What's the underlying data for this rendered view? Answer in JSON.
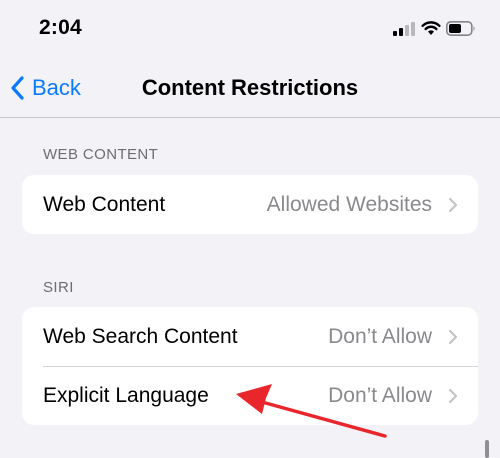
{
  "status_bar": {
    "time": "2:04",
    "icons": [
      "cellular-signal-icon",
      "wifi-icon",
      "battery-icon"
    ]
  },
  "nav": {
    "back_label": "Back",
    "title": "Content Restrictions"
  },
  "sections": {
    "web_content": {
      "header": "WEB CONTENT",
      "rows": [
        {
          "label": "Web Content",
          "value": "Allowed Websites"
        }
      ]
    },
    "siri": {
      "header": "SIRI",
      "rows": [
        {
          "label": "Web Search Content",
          "value": "Don’t Allow"
        },
        {
          "label": "Explicit Language",
          "value": "Don’t Allow"
        }
      ]
    }
  },
  "colors": {
    "accent": "#0a7aff",
    "background": "#f2f2f7",
    "annotation_arrow": "#e8262b",
    "secondary_text": "#8a8a8e"
  }
}
